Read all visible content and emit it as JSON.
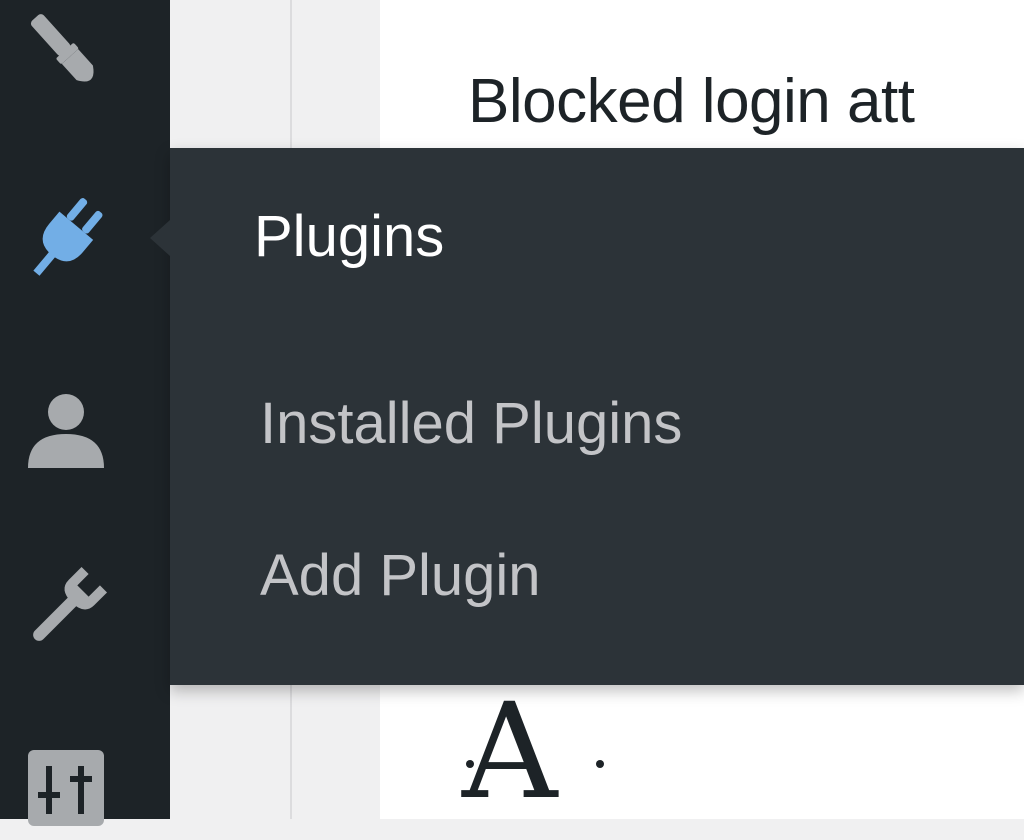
{
  "content": {
    "title": "Blocked login att",
    "font_preview_letter": "A"
  },
  "sidebar": {
    "icons": [
      "paintbrush-icon",
      "plug-icon",
      "user-icon",
      "wrench-icon",
      "sliders-icon"
    ],
    "active_color": "#72aee6",
    "icon_color": "#a7aaad"
  },
  "flyout": {
    "header": "Plugins",
    "items": [
      {
        "label": "Installed Plugins"
      },
      {
        "label": "Add Plugin"
      }
    ]
  }
}
